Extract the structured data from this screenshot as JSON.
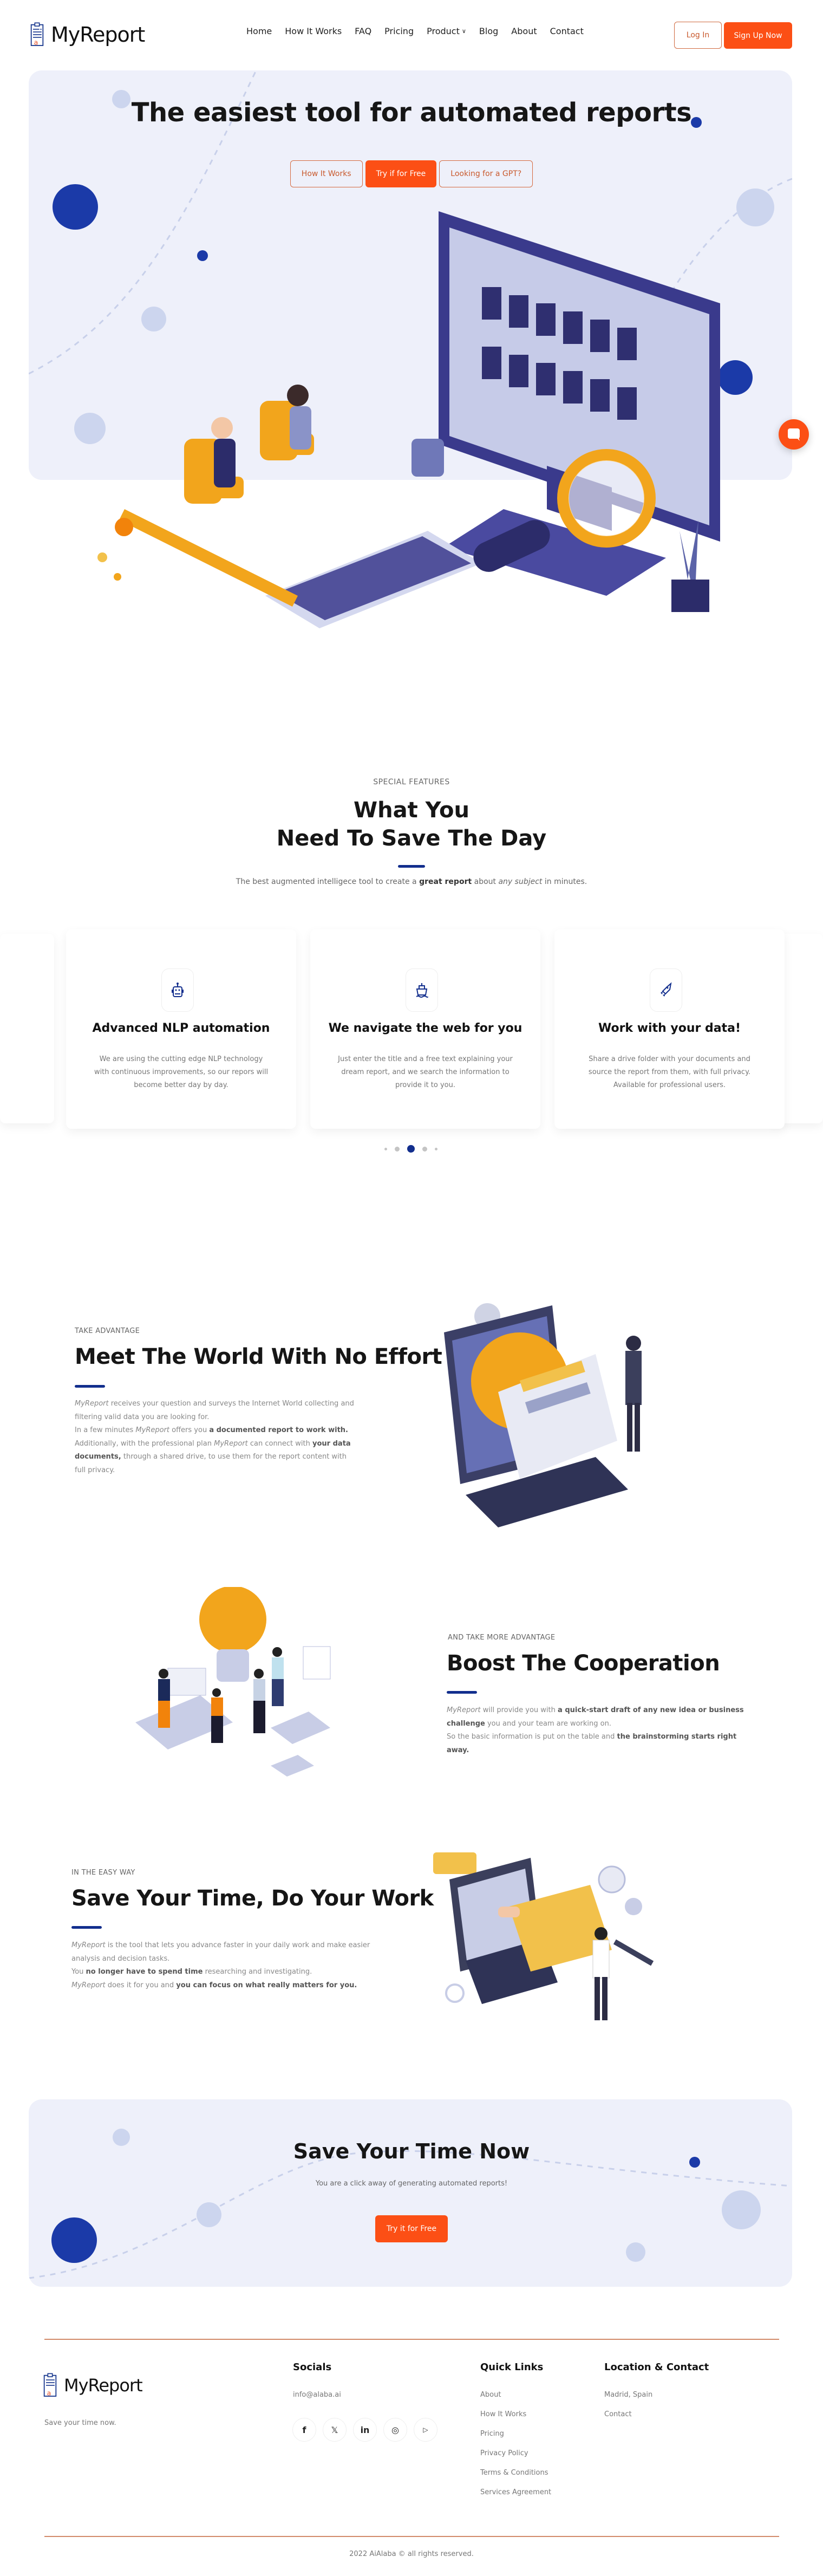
{
  "brand": {
    "name": "MyReport",
    "accent": "#fc4f15",
    "primary": "#122e8d",
    "hero_bg": "#eef0fa"
  },
  "nav": {
    "items": [
      {
        "label": "Home"
      },
      {
        "label": "How It Works"
      },
      {
        "label": "FAQ"
      },
      {
        "label": "Pricing"
      },
      {
        "label": "Product",
        "dropdown": true
      },
      {
        "label": "Blog"
      },
      {
        "label": "About"
      },
      {
        "label": "Contact"
      }
    ],
    "login": "Log In",
    "signup": "Sign Up Now"
  },
  "hero": {
    "title": "The easiest tool for automated reports",
    "buttons": [
      "How It Works",
      "Try if for Free",
      "Looking for a GPT?"
    ]
  },
  "features": {
    "eyebrow": "SPECIAL FEATURES",
    "title_line1": "What You",
    "title_line2": "Need To Save The Day",
    "subtitle_pre": "The best augmented intelligece tool to create a ",
    "subtitle_bold": "great report",
    "subtitle_mid": " about ",
    "subtitle_italic": "any subject",
    "subtitle_post": " in minutes.",
    "cards": [
      {
        "icon": "robot-icon",
        "title": "Advanced NLP automation",
        "desc": "We are using the cutting edge NLP technology with continuous improvements, so our repors will become better day by day."
      },
      {
        "icon": "ship-icon",
        "title": "We navigate the web for you",
        "desc": "Just enter the title and a free text explaining your dream report, and we search the information to provide it to you."
      },
      {
        "icon": "rocket-icon",
        "title": "Work with your data!",
        "desc": "Share a drive folder with your documents and source the report from them, with full privacy. Available for professional users."
      }
    ],
    "carousel": {
      "count": 5,
      "active": 3
    }
  },
  "section1": {
    "eyebrow": "TAKE ADVANTAGE",
    "title": "Meet The World With No Effort",
    "p1_italic": "MyReport",
    "p1_text": " receives your question and surveys the Internet World collecting and filtering valid data you are looking for.",
    "p2_pre": "In a few minutes ",
    "p2_italic": "MyReport",
    "p2_mid": " offers you ",
    "p2_bold": "a documented report to work with.",
    "p3_pre": "Additionally, with the professional plan ",
    "p3_italic": "MyReport",
    "p3_mid": " can connect with ",
    "p3_bold": "your data documents,",
    "p3_post": " through a shared drive, to use them for the report content with full privacy."
  },
  "section2": {
    "eyebrow": "AND TAKE MORE ADVANTAGE",
    "title": "Boost The Cooperation",
    "p1_italic": "MyReport",
    "p1_mid": " will provide you with ",
    "p1_bold": "a quick-start draft of any new idea or business challenge",
    "p1_post": " you and your team are working on.",
    "p2_pre": "So the basic information is put on the table and ",
    "p2_bold": "the brainstorming starts right away."
  },
  "section3": {
    "eyebrow": "IN THE EASY WAY",
    "title": "Save Your Time, Do Your Work",
    "p1_italic": "MyReport",
    "p1_text": " is the tool that lets you advance faster in your daily work and make easier analysis and decision tasks.",
    "p2_pre": "You ",
    "p2_bold": "no longer have to spend time",
    "p2_post": " researching and investigating.",
    "p3_italic": "MyReport",
    "p3_mid": " does it for you and ",
    "p3_bold": "you can focus on what really matters for you."
  },
  "cta": {
    "title": "Save Your Time Now",
    "subtitle": "You are a click away of generating automated reports!",
    "button": "Try it for Free"
  },
  "footer": {
    "tagline": "Save your time now.",
    "socials_title": "Socials",
    "email": "info@alaba.ai",
    "social_icons": [
      "f",
      "𝕏",
      "in",
      "◎",
      "▷"
    ],
    "quick_links_title": "Quick Links",
    "quick_links": [
      "About",
      "How It Works",
      "Pricing",
      "Privacy Policy",
      "Terms & Conditions",
      "Services Agreement"
    ],
    "location_title": "Location & Contact",
    "location_links": [
      "Madrid, Spain",
      "Contact"
    ],
    "copyright": "2022 AiAlaba © all rights reserved."
  }
}
